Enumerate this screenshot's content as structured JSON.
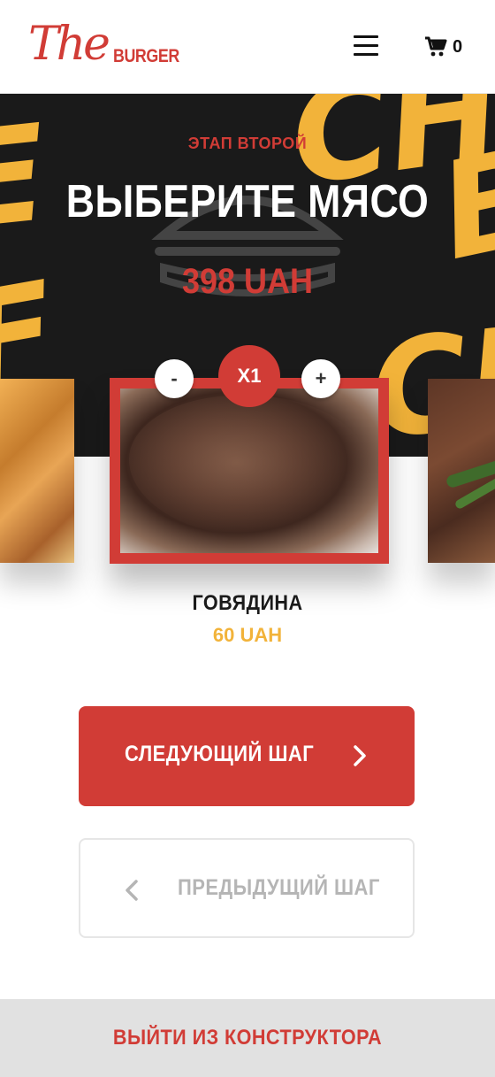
{
  "header": {
    "logo_script": "The",
    "logo_brand": "BURGER",
    "cart_count": "0",
    "menu_icon": "hamburger-menu-icon",
    "cart_icon": "shopping-cart-icon"
  },
  "hero": {
    "step_label": "ЭТАП ВТОРОЙ",
    "title": "ВЫБЕРИТЕ МЯСО",
    "total_price": "398 UAH",
    "decor_letters": [
      "CH",
      "B",
      "E",
      "F",
      "CH"
    ]
  },
  "selector": {
    "minus_label": "-",
    "quantity_label": "X1",
    "plus_label": "+",
    "product_name": "ГОВЯДИНА",
    "product_price": "60 UAH"
  },
  "actions": {
    "next_label": "СЛЕДУЮЩИЙ ШАГ",
    "prev_label": "ПРЕДЫДУЩИЙ ШАГ",
    "exit_label": "ВЫЙТИ ИЗ КОНСТРУКТОРА"
  },
  "colors": {
    "accent_red": "#d13c36",
    "accent_yellow": "#f2b33a",
    "hero_bg": "#1a1a1a",
    "exit_bg": "#e1e1e1"
  }
}
